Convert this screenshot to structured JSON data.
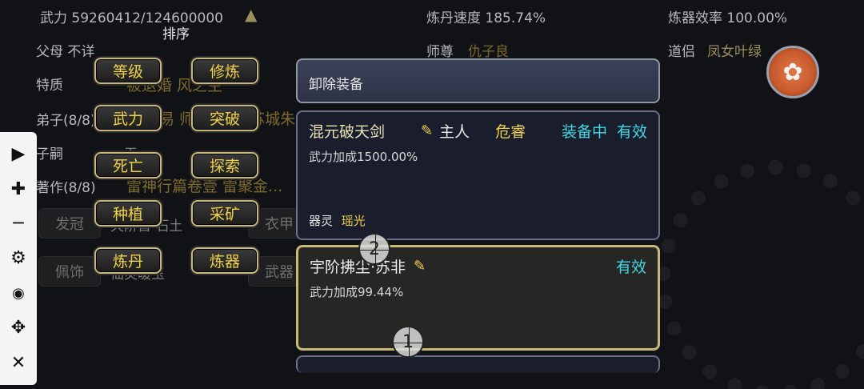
{
  "stats": {
    "power": "武力 59260412/124600000",
    "alchemy_speed": "炼丹速度 185.74%",
    "forge_eff": "炼器效率 100.00%",
    "parents": "父母 不详",
    "master_label": "师尊",
    "master_value": "仇子良",
    "partner_label": "道侣",
    "partner_value": "凤女叶绿",
    "trait_label": "特质",
    "trait_value": "被退婚 风之主",
    "disciples_label": "弟子(8/8)",
    "disciples_value": "不易 师萱 蜂鸣 苏城朱",
    "heirs_label": "子嗣",
    "heirs_value": "无",
    "works_label": "著作(8/8)",
    "works_value": "雷神行篇卷壹 雷聚金..."
  },
  "equip_slots": {
    "crown": "发冠",
    "crown_item": "天阶首·石土",
    "robe": "衣甲",
    "accessory": "佩饰",
    "accessory_item": "仙灵暖玉",
    "weapon": "武器"
  },
  "sort": {
    "title": "排序",
    "buttons": [
      "等级",
      "修炼",
      "武力",
      "突破",
      "死亡",
      "探索",
      "种植",
      "采矿",
      "炼丹",
      "炼器"
    ]
  },
  "panel": {
    "unequip": "卸除装备",
    "items": [
      {
        "name": "混元破天剑",
        "owner": "主人",
        "status": "危睿",
        "equip_state": "装备中",
        "valid": "有效",
        "bonus": "武力加成1500.00%",
        "spirit_label": "器灵",
        "spirit_value": "瑶光"
      },
      {
        "name": "宇阶拂尘·苏非",
        "valid": "有效",
        "bonus": "武力加成99.44%"
      }
    ]
  },
  "markers": [
    "2",
    "1"
  ],
  "toolbar": [
    "play-icon",
    "plus-icon",
    "minus-icon",
    "gear-icon",
    "eye-off-icon",
    "move-icon",
    "close-icon"
  ],
  "colors": {
    "accent_gold": "#f0d24a",
    "accent_cyan": "#42d8e6",
    "panel": "#2d3247"
  }
}
